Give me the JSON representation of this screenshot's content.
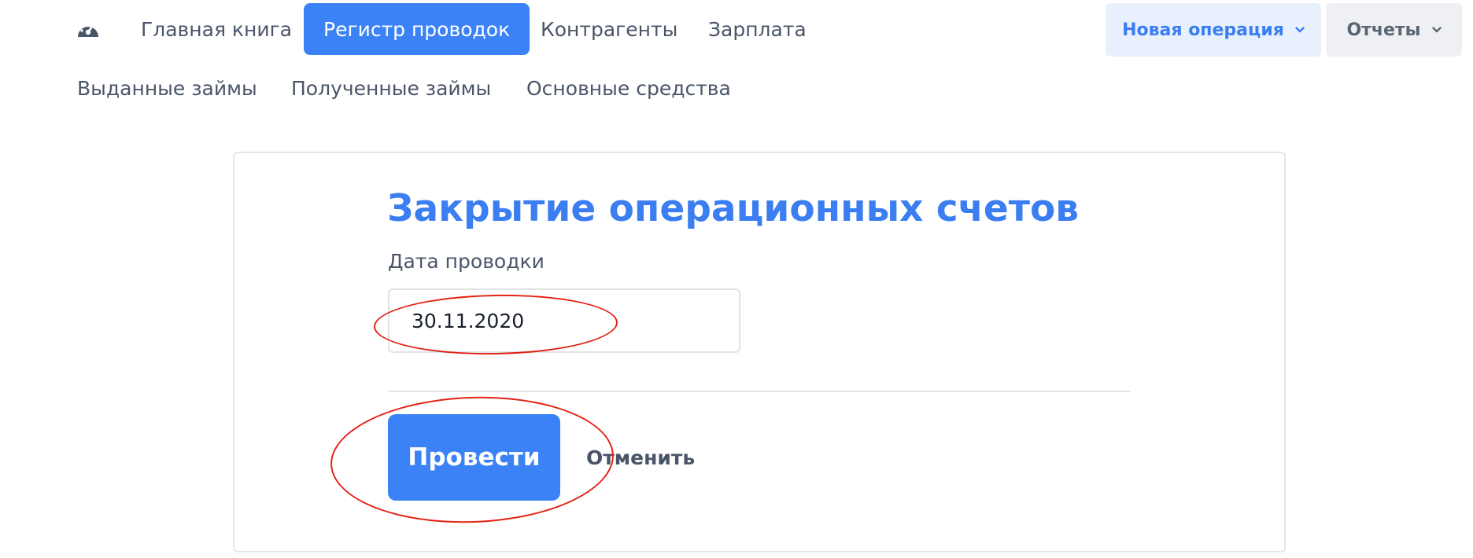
{
  "nav": {
    "items": [
      {
        "label": "Главная книга"
      },
      {
        "label": "Регистр проводок",
        "active": true
      },
      {
        "label": "Контрагенты"
      },
      {
        "label": "Зарплата"
      }
    ],
    "row2": [
      {
        "label": "Выданные займы"
      },
      {
        "label": "Полученные займы"
      },
      {
        "label": "Основные средства"
      }
    ],
    "dashboard_icon": "speedometer-icon",
    "new_operation_label": "Новая операция",
    "reports_label": "Отчеты"
  },
  "form": {
    "title": "Закрытие операционных счетов",
    "date_label": "Дата проводки",
    "date_value": "30.11.2020",
    "submit_label": "Провести",
    "cancel_label": "Отменить"
  },
  "colors": {
    "accent": "#3b82f6",
    "annotation": "#e32212"
  }
}
